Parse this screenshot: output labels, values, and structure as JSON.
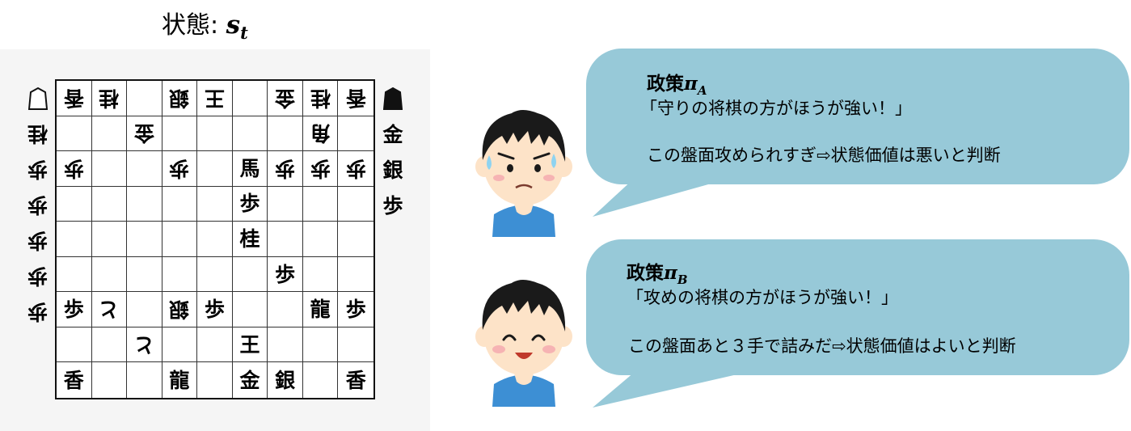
{
  "title": {
    "label": "状態: ",
    "symbol": "s",
    "subscript": "t"
  },
  "hands": {
    "gote": [
      "桂",
      "歩",
      "歩",
      "歩",
      "歩",
      "歩"
    ],
    "sente": [
      "金",
      "銀",
      "歩"
    ]
  },
  "board": [
    [
      {
        "p": "香",
        "g": true
      },
      {
        "p": "桂",
        "g": true
      },
      {
        "p": ""
      },
      {
        "p": "銀",
        "g": true
      },
      {
        "p": "王",
        "g": true
      },
      {
        "p": ""
      },
      {
        "p": "金",
        "g": true
      },
      {
        "p": "桂",
        "g": true
      },
      {
        "p": "香",
        "g": true
      }
    ],
    [
      {
        "p": ""
      },
      {
        "p": ""
      },
      {
        "p": "金",
        "g": true
      },
      {
        "p": ""
      },
      {
        "p": ""
      },
      {
        "p": ""
      },
      {
        "p": ""
      },
      {
        "p": "角",
        "g": true
      },
      {
        "p": ""
      }
    ],
    [
      {
        "p": "歩",
        "g": true
      },
      {
        "p": ""
      },
      {
        "p": ""
      },
      {
        "p": "歩",
        "g": true
      },
      {
        "p": ""
      },
      {
        "p": "馬"
      },
      {
        "p": "歩",
        "g": true
      },
      {
        "p": "歩",
        "g": true
      },
      {
        "p": "歩",
        "g": true
      }
    ],
    [
      {
        "p": ""
      },
      {
        "p": ""
      },
      {
        "p": ""
      },
      {
        "p": ""
      },
      {
        "p": ""
      },
      {
        "p": "歩"
      },
      {
        "p": ""
      },
      {
        "p": ""
      },
      {
        "p": ""
      }
    ],
    [
      {
        "p": ""
      },
      {
        "p": ""
      },
      {
        "p": ""
      },
      {
        "p": ""
      },
      {
        "p": ""
      },
      {
        "p": "桂"
      },
      {
        "p": ""
      },
      {
        "p": ""
      },
      {
        "p": ""
      }
    ],
    [
      {
        "p": ""
      },
      {
        "p": ""
      },
      {
        "p": ""
      },
      {
        "p": ""
      },
      {
        "p": ""
      },
      {
        "p": ""
      },
      {
        "p": "歩"
      },
      {
        "p": ""
      },
      {
        "p": ""
      }
    ],
    [
      {
        "p": "歩"
      },
      {
        "p": "と",
        "g": true
      },
      {
        "p": ""
      },
      {
        "p": "銀",
        "g": true
      },
      {
        "p": "歩"
      },
      {
        "p": ""
      },
      {
        "p": ""
      },
      {
        "p": "龍"
      },
      {
        "p": "歩"
      }
    ],
    [
      {
        "p": ""
      },
      {
        "p": ""
      },
      {
        "p": "と",
        "g": true
      },
      {
        "p": ""
      },
      {
        "p": ""
      },
      {
        "p": "王"
      },
      {
        "p": ""
      },
      {
        "p": ""
      },
      {
        "p": ""
      }
    ],
    [
      {
        "p": "香"
      },
      {
        "p": ""
      },
      {
        "p": ""
      },
      {
        "p": "龍"
      },
      {
        "p": ""
      },
      {
        "p": "金"
      },
      {
        "p": "銀"
      },
      {
        "p": ""
      },
      {
        "p": "香"
      }
    ]
  ],
  "policies": [
    {
      "name": "政策",
      "symbol": "π",
      "sub": "A",
      "quote": "「守りの将棋の方がほうが強い！」",
      "judgement": "この盤面攻められすぎ⇨状態価値は悪いと判断",
      "face": "worried"
    },
    {
      "name": "政策",
      "symbol": "π",
      "sub": "B",
      "quote": "「攻めの将棋の方がほうが強い！」",
      "judgement": "この盤面あと３手で詰みだ⇨状態価値はよいと判断",
      "face": "happy"
    }
  ],
  "colors": {
    "bubble": "#97c9d8",
    "shirt": "#3d8fd4",
    "skin": "#fde3c8",
    "hair": "#1a1a1a"
  }
}
